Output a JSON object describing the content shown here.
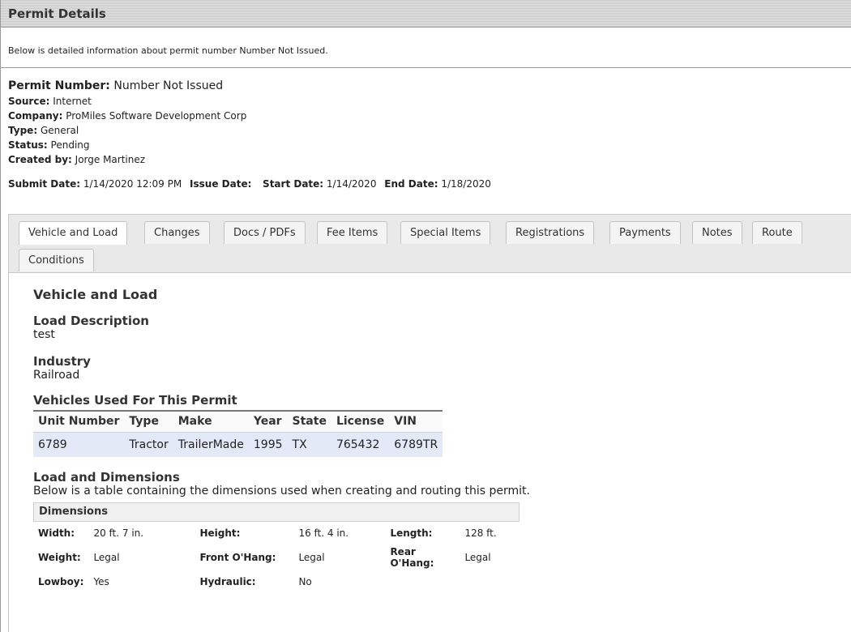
{
  "header": {
    "title": "Permit Details"
  },
  "intro": {
    "text": "Below is detailed information about permit number Number Not Issued."
  },
  "permit": {
    "number_label": "Permit Number:",
    "number": "Number Not Issued",
    "source_label": "Source:",
    "source": "Internet",
    "company_label": "Company:",
    "company": "ProMiles Software Development Corp",
    "type_label": "Type:",
    "type": "General",
    "status_label": "Status:",
    "status": "Pending",
    "created_label": "Created by:",
    "created_by": "Jorge Martinez"
  },
  "dates": {
    "submit_label": "Submit Date:",
    "submit": "1/14/2020 12:09 PM",
    "issue_label": "Issue Date:",
    "issue": "",
    "start_label": "Start Date:",
    "start": "1/14/2020",
    "end_label": "End Date:",
    "end": "1/18/2020"
  },
  "tabs": [
    {
      "label": "Vehicle and Load",
      "active": true
    },
    {
      "label": "Changes"
    },
    {
      "label": "Docs / PDFs"
    },
    {
      "label": "Fee Items"
    },
    {
      "label": "Special Items"
    },
    {
      "label": "Registrations"
    },
    {
      "label": "Payments"
    },
    {
      "label": "Notes"
    },
    {
      "label": "Route"
    },
    {
      "label": "Conditions"
    }
  ],
  "panel": {
    "title": "Vehicle and Load",
    "load_description_label": "Load Description",
    "load_description": "test",
    "industry_label": "Industry",
    "industry": "Railroad",
    "vehicles_label": "Vehicles Used For This Permit",
    "vehicle_columns": [
      "Unit Number",
      "Type",
      "Make",
      "Year",
      "State",
      "License",
      "VIN"
    ],
    "vehicles": [
      [
        "6789",
        "Tractor",
        "TrailerMade",
        "1995",
        "TX",
        "765432",
        "6789TR"
      ]
    ],
    "dimensions_label": "Load and Dimensions",
    "dimensions_desc": "Below is a table containing the dimensions used when creating and routing this permit.",
    "dimensions_header": "Dimensions",
    "dimensions": [
      [
        "Width:",
        "20 ft. 7 in.",
        "Height:",
        "16 ft. 4 in.",
        "Length:",
        "128 ft."
      ],
      [
        "Weight:",
        "Legal",
        "Front O'Hang:",
        "Legal",
        "Rear O'Hang:",
        "Legal"
      ],
      [
        "Lowboy:",
        "Yes",
        "Hydraulic:",
        "No",
        "",
        ""
      ]
    ]
  }
}
